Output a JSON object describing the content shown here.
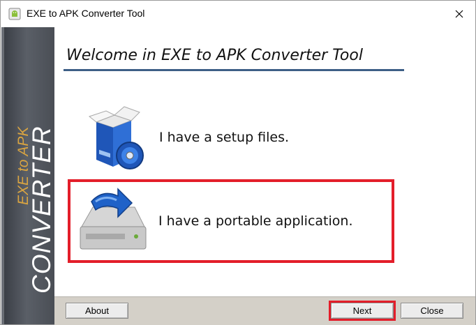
{
  "window": {
    "title": "EXE to APK Converter Tool",
    "close_glyph": "✕"
  },
  "sidebar": {
    "brand_line1": "EXE to APK",
    "brand_line2": "CONVERTER",
    "brand_accent_color": "#d9a441"
  },
  "main": {
    "heading": "Welcome in EXE to APK Converter Tool",
    "options": [
      {
        "label": "I have a setup files.",
        "icon": "setup-box-icon",
        "highlighted": false
      },
      {
        "label": "I have a portable application.",
        "icon": "drive-download-icon",
        "highlighted": true
      }
    ]
  },
  "footer": {
    "about_label": "About",
    "next_label": "Next",
    "close_label": "Close"
  },
  "colors": {
    "highlight": "#e31e2a",
    "heading_underline": "#3d5f86"
  }
}
